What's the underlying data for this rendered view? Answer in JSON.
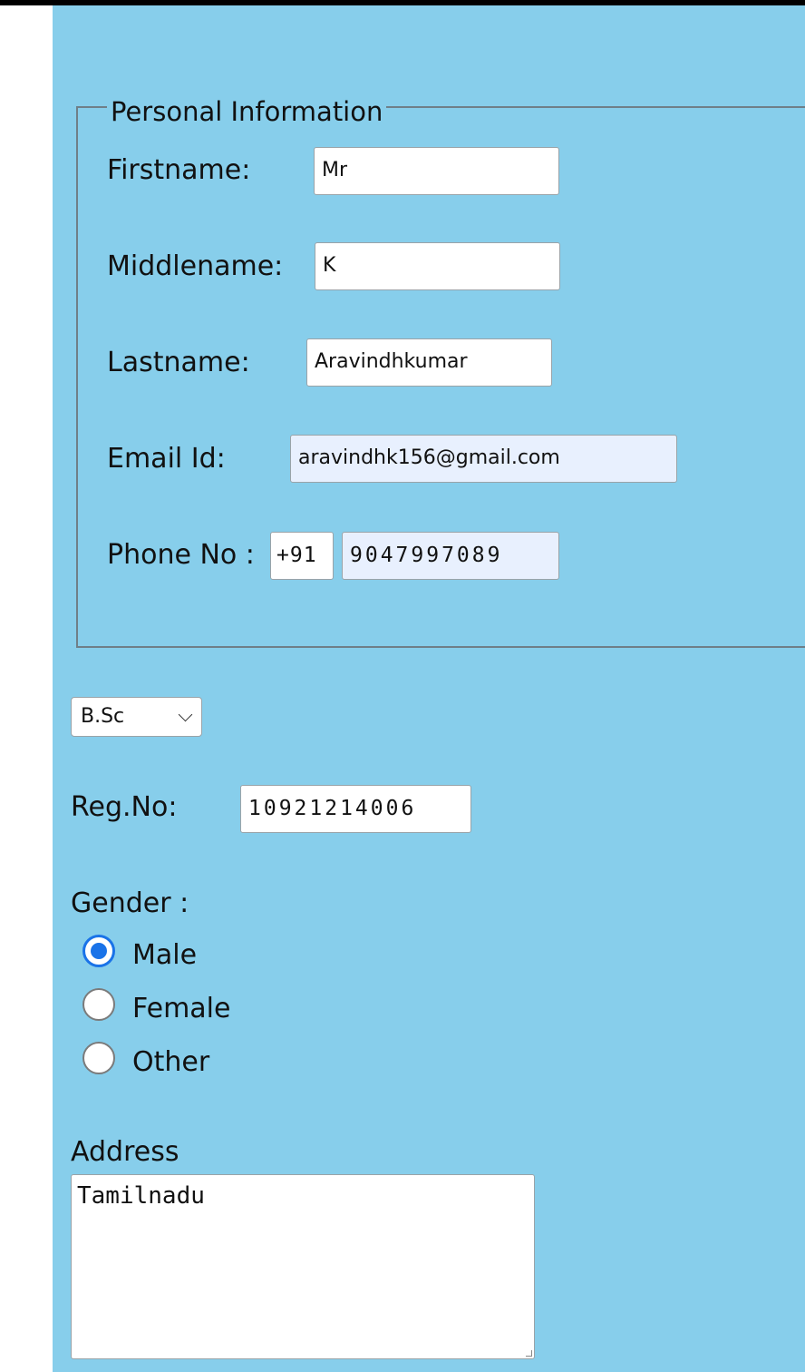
{
  "personal_info": {
    "legend": "Personal Information",
    "firstname": {
      "label": "Firstname:",
      "value": "Mr"
    },
    "middlename": {
      "label": "Middlename:",
      "value": "K"
    },
    "lastname": {
      "label": "Lastname:",
      "value": "Aravindhkumar"
    },
    "email": {
      "label": "Email Id:",
      "value": "aravindhk156@gmail.com"
    },
    "phone": {
      "label": "Phone No :",
      "country_code": "+91",
      "number": "9047997089"
    }
  },
  "course": {
    "selected": "B.Sc"
  },
  "regno": {
    "label": "Reg.No:",
    "value": "10921214006"
  },
  "gender": {
    "label": "Gender :",
    "options": [
      {
        "label": "Male",
        "checked": true
      },
      {
        "label": "Female",
        "checked": false
      },
      {
        "label": "Other",
        "checked": false
      }
    ]
  },
  "address": {
    "label": "Address",
    "value": "Tamilnadu"
  },
  "colors": {
    "page_bg": "#87CEEB",
    "autofill_bg": "#e8f0fe",
    "radio_accent": "#1a73e8"
  }
}
